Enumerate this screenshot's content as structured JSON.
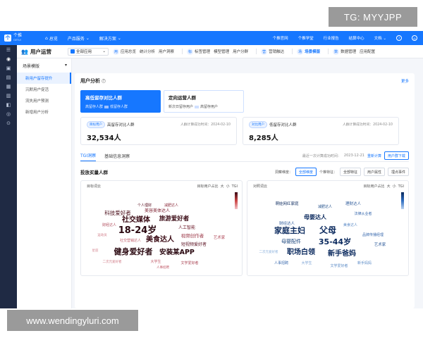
{
  "overlay": {
    "top_text": "TG: MYYJPP",
    "bottom_text": "www.wendingyluri.com"
  },
  "topnav": {
    "logo_mark": "个",
    "logo_name": "个推",
    "logo_sub": "GETUI",
    "items": [
      {
        "label": "总览",
        "icon": "home-icon"
      },
      {
        "label": "产品服务",
        "icon": "chevron-down-icon"
      },
      {
        "label": "解决方案",
        "icon": "chevron-down-icon"
      }
    ],
    "right": [
      "个推官网",
      "个推学堂",
      "行业报告",
      "结算中心",
      "文档"
    ],
    "doc_chevron": "⌄"
  },
  "rail": {
    "icons": [
      "menu-icon",
      "users-icon",
      "tag-icon",
      "chart-icon",
      "folder-icon",
      "message-icon",
      "box-icon",
      "settings-icon",
      "search-icon"
    ]
  },
  "modbar": {
    "title": "用户运营",
    "app_select": "全部应用",
    "groups": [
      {
        "icon": "用",
        "tabs": [
          {
            "label": "应用总览",
            "active": false
          },
          {
            "label": "统计分析",
            "active": false
          },
          {
            "label": "用户洞察",
            "active": false
          }
        ]
      },
      {
        "icon": "标",
        "tabs": [
          {
            "label": "标签管理",
            "active": false
          },
          {
            "label": "模型管理",
            "active": false
          },
          {
            "label": "用户分群",
            "active": false
          }
        ]
      },
      {
        "icon": "营",
        "tabs": [
          {
            "label": "营销触达",
            "active": false
          }
        ]
      },
      {
        "icon": "场",
        "tabs": [
          {
            "label": "场景模版",
            "active": true
          }
        ]
      },
      {
        "icon": "数",
        "tabs": [
          {
            "label": "数据管理",
            "active": false
          },
          {
            "label": "应用配置",
            "active": false
          }
        ]
      }
    ]
  },
  "subside": {
    "header": "场景模版",
    "items": [
      {
        "label": "新用户留存提升",
        "active": true
      },
      {
        "label": "沉默用户促活",
        "active": false
      },
      {
        "label": "流失用户预测",
        "active": false
      },
      {
        "label": "新增用户分析",
        "active": false
      }
    ]
  },
  "main": {
    "title": "用户分析",
    "more": "更多",
    "segments": [
      {
        "title": "高低留存对比人群",
        "sub1": "高留存人群",
        "sub2": "低留存人群",
        "active": true
      },
      {
        "title": "定向运营人群",
        "sub1": "新次日留存用户",
        "sub2": "高留存用户",
        "active": false
      }
    ],
    "stats": [
      {
        "badge": "目标用户",
        "name": "高留存对比人群",
        "time_label": "人群计算成功时间：2024-02-10",
        "value": "32,534人"
      },
      {
        "badge": "对比用户",
        "name": "低留存对比人群",
        "time_label": "人群计算成功时间：2024-02-10",
        "value": "8,285人"
      }
    ],
    "tabs": [
      {
        "label": "TGI洞察",
        "active": true
      },
      {
        "label": "基础信息洞察",
        "active": false
      }
    ],
    "last_calc": "最近一次计算成功时间：",
    "last_calc_time": "2023-12-21",
    "recalc": "重新计算",
    "download": "用户群下载",
    "feature_title": "投放买量人群",
    "dimension_label": "洞察维度：",
    "dimension_value": "全部维度",
    "single_label": "个推特征：",
    "single_value": "全部特征",
    "btn_user_attr": "用户属性",
    "btn_event": "埋点事件",
    "panels": [
      {
        "title": "目标词云",
        "legend": "目标用户占比",
        "size_big": "大",
        "size_small": "小",
        "tgi": "TGI",
        "scheme": "red"
      },
      {
        "title": "对照词云",
        "legend": "目标用户占比",
        "size_big": "大",
        "size_small": "小",
        "tgi": "TGI",
        "scheme": "blue"
      }
    ]
  },
  "cloud_target": [
    {
      "text": "个人理财",
      "size": 5,
      "color": "#5a1020"
    },
    {
      "text": "减肥达人",
      "size": 5,
      "color": "#8a2a3a"
    },
    {
      "text": "科技爱好者",
      "size": 7.5,
      "color": "#4a0c18"
    },
    {
      "text": "美容美体达人",
      "size": 6,
      "color": "#7a1c2c"
    },
    {
      "text": "旅游爱好者",
      "size": 8.5,
      "color": "#3a0a14"
    },
    {
      "text": "社交媒体",
      "size": 10,
      "color": "#3a0a14"
    },
    {
      "text": "18-24岁",
      "size": 13,
      "color": "#2a0810"
    },
    {
      "text": "人工智能",
      "size": 6,
      "color": "#6a1626"
    },
    {
      "text": "视频创作者",
      "size": 6.5,
      "color": "#9a3444"
    },
    {
      "text": "财经达人",
      "size": 5,
      "color": "#b04a5a"
    },
    {
      "text": "社交营销达人",
      "size": 5,
      "color": "#c25e6c"
    },
    {
      "text": "美食达人",
      "size": 10,
      "color": "#3a0a14"
    },
    {
      "text": "短视频爱好者",
      "size": 6,
      "color": "#5a1020"
    },
    {
      "text": "健身爱好者",
      "size": 11,
      "color": "#2a0810"
    },
    {
      "text": "安装某APP",
      "size": 9.5,
      "color": "#2a0810"
    },
    {
      "text": "艺术家",
      "size": 5.5,
      "color": "#b04a5a"
    },
    {
      "text": "大学生",
      "size": 5,
      "color": "#c25e6c"
    },
    {
      "text": "文学爱好者",
      "size": 5,
      "color": "#a84050"
    },
    {
      "text": "二次元爱好者",
      "size": 4.5,
      "color": "#d07a86"
    },
    {
      "text": "人事招聘",
      "size": 4.5,
      "color": "#c25e6c"
    },
    {
      "text": "运动员",
      "size": 4.5,
      "color": "#d07a86"
    },
    {
      "text": "星座",
      "size": 4.5,
      "color": "#d88e98"
    }
  ],
  "cloud_control": [
    {
      "text": "萌娃网红家庭",
      "size": 5.5,
      "color": "#0b2a5e"
    },
    {
      "text": "理财达人",
      "size": 5.5,
      "color": "#2d5a9a"
    },
    {
      "text": "减肥达人",
      "size": 5,
      "color": "#1a4a86"
    },
    {
      "text": "法律从业者",
      "size": 5,
      "color": "#3a6aae"
    },
    {
      "text": "母婴达人",
      "size": 8,
      "color": "#0b2a5e"
    },
    {
      "text": "财经达人",
      "size": 5.5,
      "color": "#2d5a9a"
    },
    {
      "text": "家庭主妇",
      "size": 11,
      "color": "#0b2a5e"
    },
    {
      "text": "父母",
      "size": 12,
      "color": "#0b2a5e"
    },
    {
      "text": "母婴配件",
      "size": 7,
      "color": "#14407a"
    },
    {
      "text": "35-44岁",
      "size": 11,
      "color": "#0b2a5e"
    },
    {
      "text": "职场白领",
      "size": 10,
      "color": "#0b2a5e"
    },
    {
      "text": "新手爸妈",
      "size": 10,
      "color": "#0b2a5e"
    },
    {
      "text": "品牌传播经理",
      "size": 5,
      "color": "#3a6aae"
    },
    {
      "text": "美食达人",
      "size": 5,
      "color": "#5a8ac6"
    },
    {
      "text": "艺术家",
      "size": 5.5,
      "color": "#2d5a9a"
    },
    {
      "text": "人事招聘",
      "size": 5,
      "color": "#3a6aae"
    },
    {
      "text": "新手妈妈",
      "size": 5,
      "color": "#5a8ac6"
    },
    {
      "text": "大学生",
      "size": 5,
      "color": "#7aa2d4"
    },
    {
      "text": "文学爱好者",
      "size": 5,
      "color": "#5a8ac6"
    },
    {
      "text": "二次元爱好者",
      "size": 4.5,
      "color": "#8ab0dc"
    }
  ]
}
